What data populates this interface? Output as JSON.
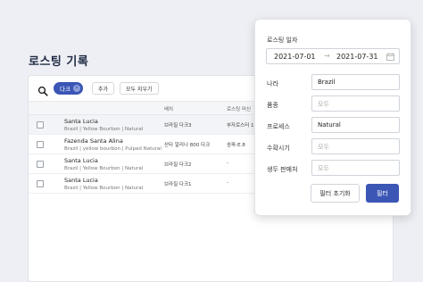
{
  "page": {
    "title": "로스팅 기록"
  },
  "toolbar": {
    "chip_label": "다크",
    "add_label": "추가",
    "clear_label": "모두 지우기"
  },
  "table": {
    "headers": [
      "배치",
      "로스팅 머신"
    ],
    "rows": [
      {
        "name": "Santa Lucia",
        "sub": "Brazil | Yellow Bourbon | Natural",
        "roast": "브라질 다크3",
        "machine": "부자로스터 1",
        "selected": true
      },
      {
        "name": "Fazenda Santa Alina",
        "sub": "Brazil | yellow bourbon | Pulped Natural",
        "roast": "산타 알리나 800 다크",
        "machine": "송파-E.8",
        "selected": false
      },
      {
        "name": "Santa Lucia",
        "sub": "Brazil | Yellow Bourbon | Natural",
        "roast": "브라질 다크2",
        "machine": "-",
        "selected": false
      },
      {
        "name": "Santa Lucia",
        "sub": "Brazil | Yellow Bourbon | Natural",
        "roast": "브라질 다크1",
        "machine": "-",
        "selected": false
      }
    ]
  },
  "filter": {
    "date_label": "로스팅 일자",
    "date_from": "2021-07-01",
    "date_to": "2021-07-31",
    "country_label": "나라",
    "country_value": "Brazil",
    "variety_label": "품종",
    "variety_placeholder": "모두",
    "process_label": "프로세스",
    "process_value": "Natural",
    "harvest_label": "수확시기",
    "harvest_placeholder": "모두",
    "seller_label": "생두 판매처",
    "seller_placeholder": "모두",
    "reset_label": "필터 초기화",
    "apply_label": "필터"
  },
  "colors": {
    "accent": "#3b56b5",
    "background": "#edeff4"
  }
}
